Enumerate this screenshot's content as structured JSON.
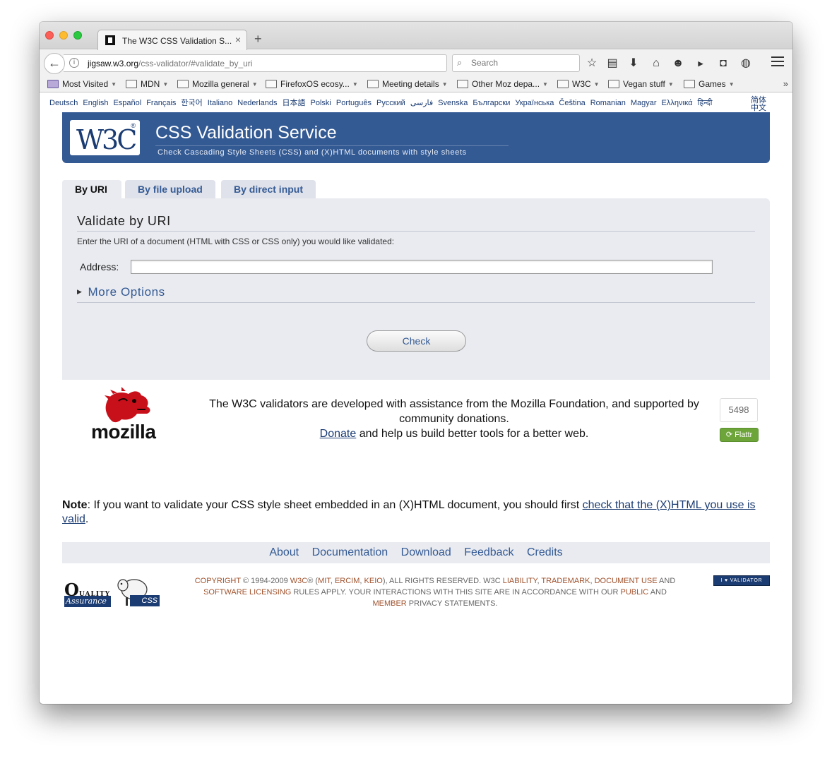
{
  "browser": {
    "tab_title": "The W3C CSS Validation S...",
    "url_host": "jigsaw.w3.org",
    "url_path": "/css-validator/#validate_by_uri",
    "search_placeholder": "Search",
    "bookmarks": [
      {
        "label": "Most Visited"
      },
      {
        "label": "MDN"
      },
      {
        "label": "Mozilla general"
      },
      {
        "label": "FirefoxOS ecosy..."
      },
      {
        "label": "Meeting details"
      },
      {
        "label": "Other Moz depa..."
      },
      {
        "label": "W3C"
      },
      {
        "label": "Vegan stuff"
      },
      {
        "label": "Games"
      }
    ]
  },
  "languages": [
    "Deutsch",
    "English",
    "Español",
    "Français",
    "한국어",
    "Italiano",
    "Nederlands",
    "日本語",
    "Polski",
    "Português",
    "Русский",
    "فارسی",
    "Svenska",
    "Български",
    "Українська",
    "Čeština",
    "Romanian",
    "Magyar",
    "Ελληνικά",
    "हिन्दी",
    "简体中文"
  ],
  "header": {
    "logo_text": "W3C",
    "title": "CSS Validation Service",
    "subtitle": "Check Cascading Style Sheets (CSS) and (X)HTML documents with style sheets"
  },
  "tabs": [
    {
      "label": "By URI",
      "active": true
    },
    {
      "label": "By file upload",
      "active": false
    },
    {
      "label": "By direct input",
      "active": false
    }
  ],
  "form": {
    "heading": "Validate by URI",
    "instructions": "Enter the URI of a document (HTML with CSS or CSS only) you would like validated:",
    "address_label": "Address:",
    "address_value": "",
    "more_options": "More Options",
    "check_label": "Check"
  },
  "support": {
    "logo_word": "mozilla",
    "line1": "The W3C validators are developed with assistance from the Mozilla Foundation, and supported by community donations.",
    "donate_link": "Donate",
    "line2": " and help us build better tools for a better web.",
    "flattr_count": "5498",
    "flattr_label": "Flattr"
  },
  "note": {
    "bold": "Note",
    "text": ": If you want to validate your CSS style sheet embedded in an (X)HTML document, you should first ",
    "link": "check that the (X)HTML you use is valid",
    "end": "."
  },
  "footer": {
    "links": [
      "About",
      "Documentation",
      "Download",
      "Feedback",
      "Credits"
    ],
    "copyright_parts": [
      "COPYRIGHT",
      " © 1994-2009 ",
      "W3C",
      "® (",
      "MIT",
      ", ",
      "ERCIM",
      ", ",
      "KEIO",
      "), ALL RIGHTS RESERVED. W3C ",
      "LIABILITY",
      ", ",
      "TRADEMARK",
      ", ",
      "DOCUMENT USE",
      " AND ",
      "SOFTWARE LICENSING",
      " RULES APPLY. YOUR INTERACTIONS WITH THIS SITE ARE IN ACCORDANCE WITH OUR ",
      "PUBLIC",
      " AND ",
      "MEMBER",
      " PRIVACY STATEMENTS."
    ],
    "qa_top": "Q",
    "qa_top_small": "UALITY",
    "qa_bottom": "Assurance",
    "css_logo_text": "CSS",
    "validator_badge": "I ♥ VALIDATOR"
  },
  "colors": {
    "w3c_blue": "#345a94",
    "panel_gray": "#e9ebf0",
    "link_blue": "#1b3c73",
    "copyright_link": "#a0522d",
    "flattr_green": "#6da53a"
  }
}
